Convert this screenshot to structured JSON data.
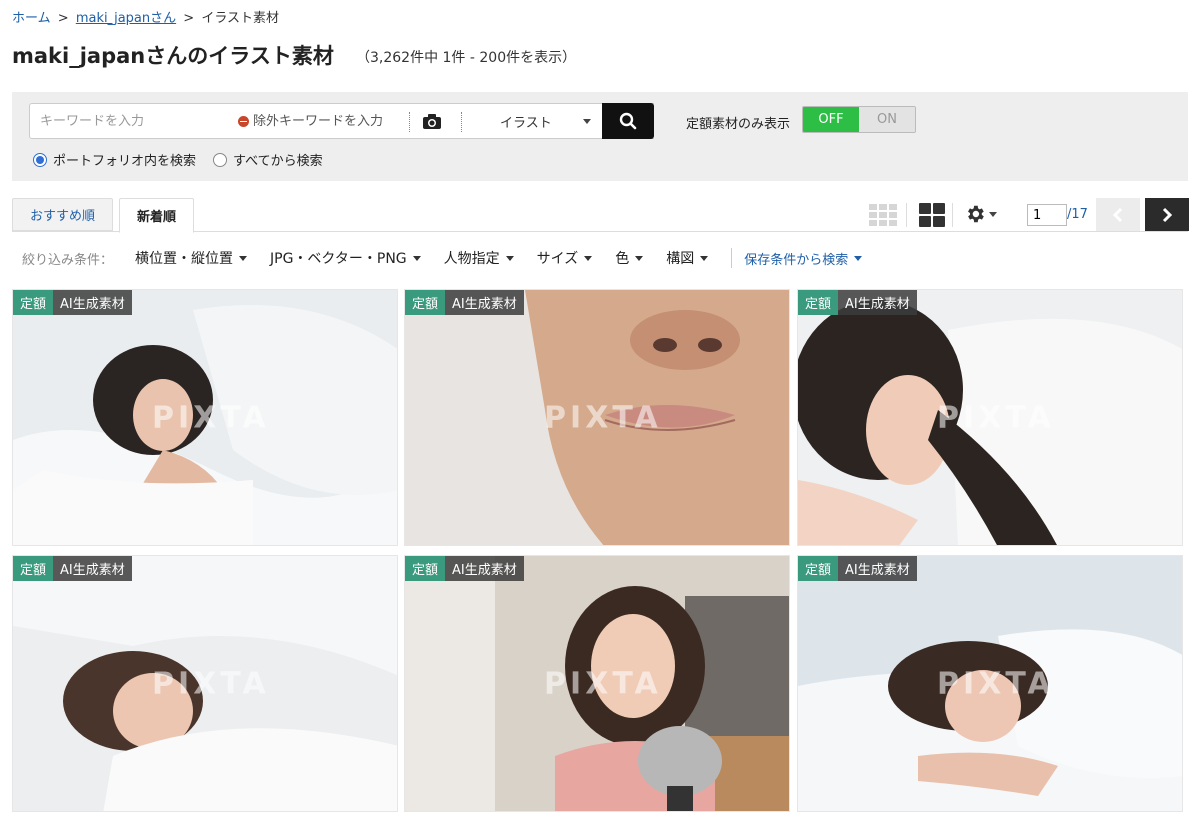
{
  "breadcrumb": {
    "home": "ホーム",
    "sep1": ">",
    "user": "maki_japanさん",
    "sep2": ">",
    "current": "イラスト素材"
  },
  "header": {
    "title": "maki_japanさんのイラスト素材",
    "count": "（3,262件中 1件 - 200件を表示）"
  },
  "search": {
    "keyword_placeholder": "キーワードを入力",
    "exclude_placeholder": "除外キーワードを入力",
    "type_value": "イラスト",
    "fixed_only_label": "定額素材のみ表示",
    "toggle_off": "OFF",
    "toggle_on": "ON",
    "scope_portfolio": "ポートフォリオ内を検索",
    "scope_all": "すべてから検索"
  },
  "tabs": [
    {
      "label": "おすすめ順"
    },
    {
      "label": "新着順"
    }
  ],
  "pager": {
    "current_page": "1",
    "total_pages": "/17"
  },
  "filters": {
    "label": "絞り込み条件：",
    "items": [
      "横位置・縦位置",
      "JPG・ベクター・PNG",
      "人物指定",
      "サイズ",
      "色",
      "構図"
    ],
    "saved": "保存条件から検索"
  },
  "images": [
    {
      "badge_fixed": "定額",
      "badge_ai": "AI生成素材",
      "watermark": "PIXTA"
    },
    {
      "badge_fixed": "定額",
      "badge_ai": "AI生成素材",
      "watermark": "PIXTA"
    },
    {
      "badge_fixed": "定額",
      "badge_ai": "AI生成素材",
      "watermark": "PIXTA"
    },
    {
      "badge_fixed": "定額",
      "badge_ai": "AI生成素材",
      "watermark": "PIXTA"
    },
    {
      "badge_fixed": "定額",
      "badge_ai": "AI生成素材",
      "watermark": "PIXTA"
    },
    {
      "badge_fixed": "定額",
      "badge_ai": "AI生成素材",
      "watermark": "PIXTA"
    }
  ],
  "colors": {
    "link": "#1e5fa8",
    "toggle_off": "#2dbe45",
    "badge_fixed": "#3a9a7e",
    "search_button": "#111111"
  }
}
